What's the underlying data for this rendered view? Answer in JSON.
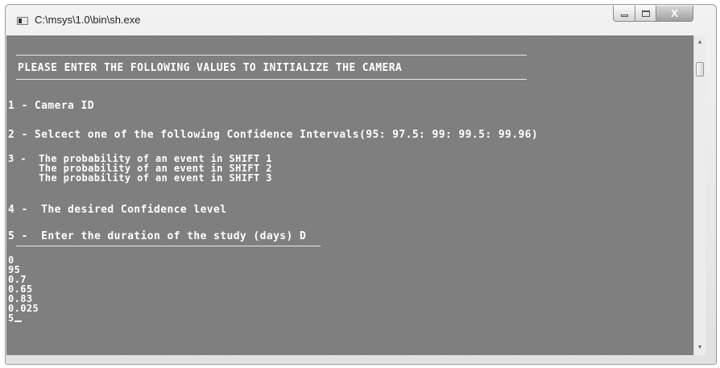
{
  "window": {
    "title": "C:\\msys\\1.0\\bin\\sh.exe",
    "close_glyph": "X"
  },
  "console": {
    "banner": "PLEASE ENTER THE FOLLOWING VALUES TO INITIALIZE THE CAMERA",
    "prompts": {
      "p1": "1 - Camera ID",
      "p2": "2 - Selcect one of the following Confidence Intervals(95: 97.5: 99: 99.5: 99.96)",
      "p3a": "3 -  The probability of an event in SHIFT 1",
      "p3b": "     The probability of an event in SHIFT 2",
      "p3c": "     The probability of an event in SHIFT 3",
      "p4": "4 -  The desired Confidence level",
      "p5": "5 -  Enter the duration of the study (days) D"
    },
    "inputs": [
      "0",
      "95",
      "0.7",
      "0.65",
      "0.83",
      "0.025",
      "5"
    ]
  },
  "colors": {
    "console_bg": "#7f7f7f",
    "console_text": "#ffffff"
  },
  "icons": {
    "app": "console-app-icon",
    "minimize": "minimize-icon",
    "maximize": "maximize-icon",
    "close": "close-icon",
    "scroll_up": "scroll-up-arrow-icon",
    "scroll_down": "scroll-down-arrow-icon"
  }
}
